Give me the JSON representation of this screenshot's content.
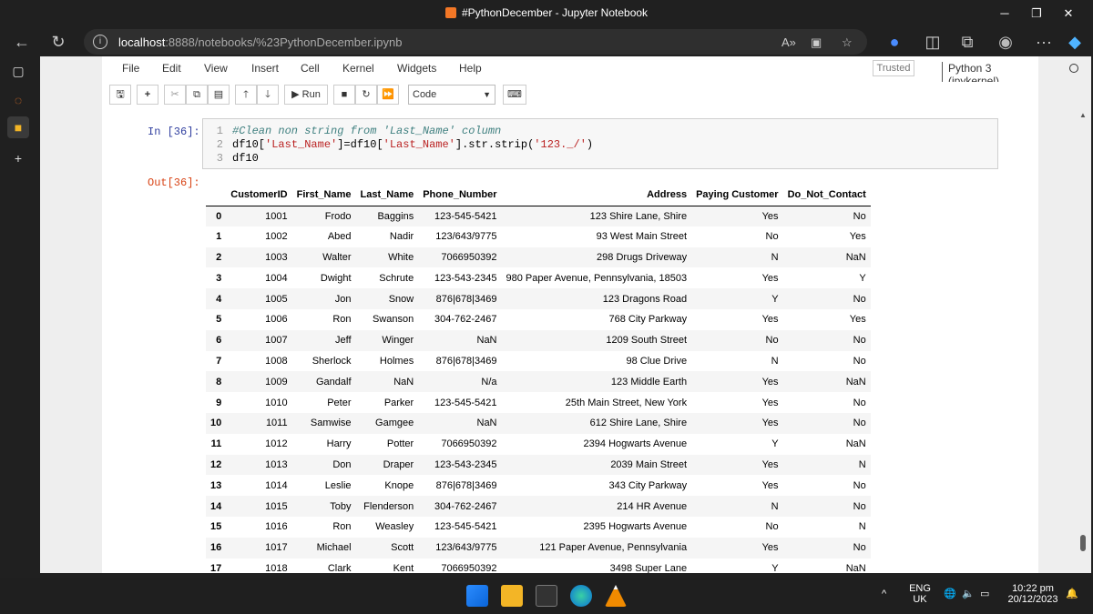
{
  "window": {
    "title": "#PythonDecember - Jupyter Notebook",
    "controls": {
      "minimize": "─",
      "maximize": "❐",
      "close": "✕"
    }
  },
  "browser": {
    "url_host": "localhost",
    "url_rest": ":8888/notebooks/%23PythonDecember.ipynb"
  },
  "notebook": {
    "menu": [
      "File",
      "Edit",
      "View",
      "Insert",
      "Cell",
      "Kernel",
      "Widgets",
      "Help"
    ],
    "trusted": "Trusted",
    "kernel": "Python 3 (ipykernel)",
    "toolbar": {
      "run_label": "Run",
      "cell_type": "Code"
    },
    "in_prompt": "In [36]:",
    "out_prompt": "Out[36]:",
    "code": {
      "line1": "#Clean non string from 'Last_Name' column",
      "line2_a": "df10[",
      "line2_b": "'Last_Name'",
      "line2_c": "]=df10[",
      "line2_d": "'Last_Name'",
      "line2_e": "].str.strip(",
      "line2_f": "'123._/'",
      "line2_g": ")",
      "line3": "df10"
    }
  },
  "table": {
    "columns": [
      "",
      "CustomerID",
      "First_Name",
      "Last_Name",
      "Phone_Number",
      "Address",
      "Paying Customer",
      "Do_Not_Contact"
    ],
    "rows": [
      [
        "0",
        "1001",
        "Frodo",
        "Baggins",
        "123-545-5421",
        "123 Shire Lane, Shire",
        "Yes",
        "No"
      ],
      [
        "1",
        "1002",
        "Abed",
        "Nadir",
        "123/643/9775",
        "93 West Main Street",
        "No",
        "Yes"
      ],
      [
        "2",
        "1003",
        "Walter",
        "White",
        "7066950392",
        "298 Drugs Driveway",
        "N",
        "NaN"
      ],
      [
        "3",
        "1004",
        "Dwight",
        "Schrute",
        "123-543-2345",
        "980 Paper Avenue, Pennsylvania, 18503",
        "Yes",
        "Y"
      ],
      [
        "4",
        "1005",
        "Jon",
        "Snow",
        "876|678|3469",
        "123 Dragons Road",
        "Y",
        "No"
      ],
      [
        "5",
        "1006",
        "Ron",
        "Swanson",
        "304-762-2467",
        "768 City Parkway",
        "Yes",
        "Yes"
      ],
      [
        "6",
        "1007",
        "Jeff",
        "Winger",
        "NaN",
        "1209 South Street",
        "No",
        "No"
      ],
      [
        "7",
        "1008",
        "Sherlock",
        "Holmes",
        "876|678|3469",
        "98 Clue Drive",
        "N",
        "No"
      ],
      [
        "8",
        "1009",
        "Gandalf",
        "NaN",
        "N/a",
        "123 Middle Earth",
        "Yes",
        "NaN"
      ],
      [
        "9",
        "1010",
        "Peter",
        "Parker",
        "123-545-5421",
        "25th Main Street, New York",
        "Yes",
        "No"
      ],
      [
        "10",
        "1011",
        "Samwise",
        "Gamgee",
        "NaN",
        "612 Shire Lane, Shire",
        "Yes",
        "No"
      ],
      [
        "11",
        "1012",
        "Harry",
        "Potter",
        "7066950392",
        "2394 Hogwarts Avenue",
        "Y",
        "NaN"
      ],
      [
        "12",
        "1013",
        "Don",
        "Draper",
        "123-543-2345",
        "2039 Main Street",
        "Yes",
        "N"
      ],
      [
        "13",
        "1014",
        "Leslie",
        "Knope",
        "876|678|3469",
        "343 City Parkway",
        "Yes",
        "No"
      ],
      [
        "14",
        "1015",
        "Toby",
        "Flenderson",
        "304-762-2467",
        "214 HR Avenue",
        "N",
        "No"
      ],
      [
        "15",
        "1016",
        "Ron",
        "Weasley",
        "123-545-5421",
        "2395 Hogwarts Avenue",
        "No",
        "N"
      ],
      [
        "16",
        "1017",
        "Michael",
        "Scott",
        "123/643/9775",
        "121 Paper Avenue, Pennsylvania",
        "Yes",
        "No"
      ],
      [
        "17",
        "1018",
        "Clark",
        "Kent",
        "7066950392",
        "3498 Super Lane",
        "Y",
        "NaN"
      ]
    ]
  },
  "taskbar": {
    "lang_top": "ENG",
    "lang_bottom": "UK",
    "time": "10:22 pm",
    "date": "20/12/2023"
  }
}
